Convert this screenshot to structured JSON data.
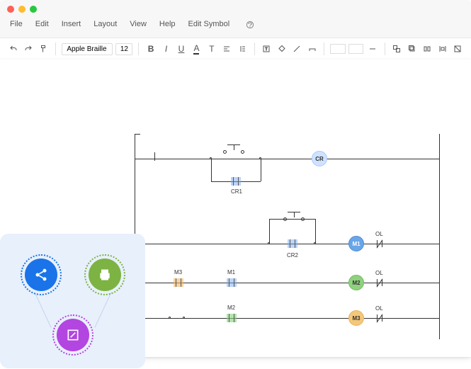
{
  "menu": {
    "file": "File",
    "edit": "Edit",
    "insert": "Insert",
    "layout": "Layout",
    "view": "View",
    "help": "Help",
    "edit_symbol": "Edit Symbol"
  },
  "toolbar": {
    "font": "Apple Braille",
    "size": "12"
  },
  "labels": {
    "cr": "CR",
    "cr1": "CR1",
    "cr2": "CR2",
    "m1": "M1",
    "m2": "M2",
    "m3": "M3",
    "ol": "OL"
  }
}
